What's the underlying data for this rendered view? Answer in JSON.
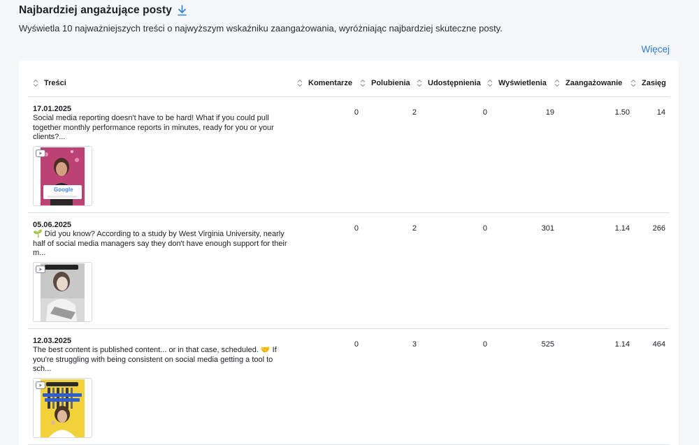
{
  "header": {
    "title": "Najbardziej angażujące posty",
    "download_icon": "download-icon",
    "description": "Wyświetla 10 najważniejszych treści o najwyższym wskaźniku zaangażowania, wyróżniając najbardziej skuteczne posty.",
    "more_label": "Więcej"
  },
  "colors": {
    "accent": "#2a7fd4",
    "background": "#f5f6f8",
    "card": "#ffffff",
    "border": "#dcdfe4"
  },
  "table": {
    "columns": [
      {
        "key": "content",
        "label": "Treści",
        "icon": "sort-icon"
      },
      {
        "key": "comments",
        "label": "Komentarze",
        "icon": "sort-icon"
      },
      {
        "key": "likes",
        "label": "Polubienia",
        "icon": "sort-icon"
      },
      {
        "key": "shares",
        "label": "Udostępnienia",
        "icon": "sort-icon"
      },
      {
        "key": "views",
        "label": "Wyświetlenia",
        "icon": "sort-icon"
      },
      {
        "key": "engagement",
        "label": "Zaangażowanie",
        "icon": "sort-icon"
      },
      {
        "key": "reach",
        "label": "Zasięg",
        "icon": "sort-icon"
      }
    ],
    "rows": [
      {
        "date": "17.01.2025",
        "text": "Social media reporting doesn't have to be hard! What if you could pull together monthly performance reports in minutes, ready for you or your clients?...",
        "thumb_icon": "video-icon",
        "thumb_caption": "Google",
        "comments": "0",
        "likes": "2",
        "shares": "0",
        "views": "19",
        "engagement": "1.50",
        "reach": "14"
      },
      {
        "date": "05.06.2025",
        "text": "🌱 Did you know? According to a study by West Virginia University, nearly half of social media managers say they don't have enough support for their m...",
        "thumb_icon": "video-icon",
        "comments": "0",
        "likes": "2",
        "shares": "0",
        "views": "301",
        "engagement": "1.14",
        "reach": "266"
      },
      {
        "date": "12.03.2025",
        "text": "The best content is published content... or in that case, scheduled. 🤝 If you're struggling with being consistent on social media getting a tool to sch...",
        "thumb_icon": "video-icon",
        "comments": "0",
        "likes": "3",
        "shares": "0",
        "views": "525",
        "engagement": "1.14",
        "reach": "464"
      }
    ]
  }
}
